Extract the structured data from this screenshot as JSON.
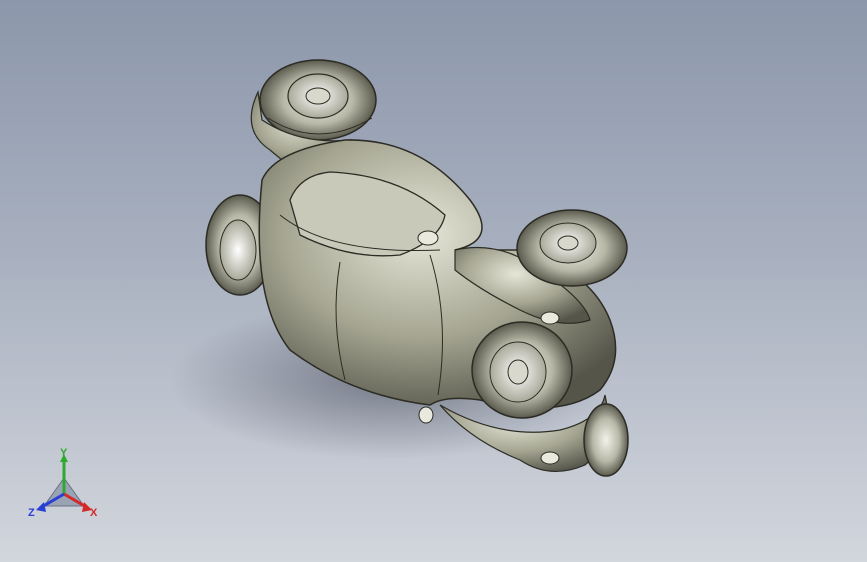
{
  "viewport": {
    "background_top": "#8c97ab",
    "background_bottom": "#d2d6dd",
    "model": "buggy-car-assembly"
  },
  "triad": {
    "x_label": "X",
    "y_label": "Y",
    "z_label": "Z",
    "x_color": "#d42a2a",
    "y_color": "#2fa82f",
    "z_color": "#2a3fd4"
  }
}
